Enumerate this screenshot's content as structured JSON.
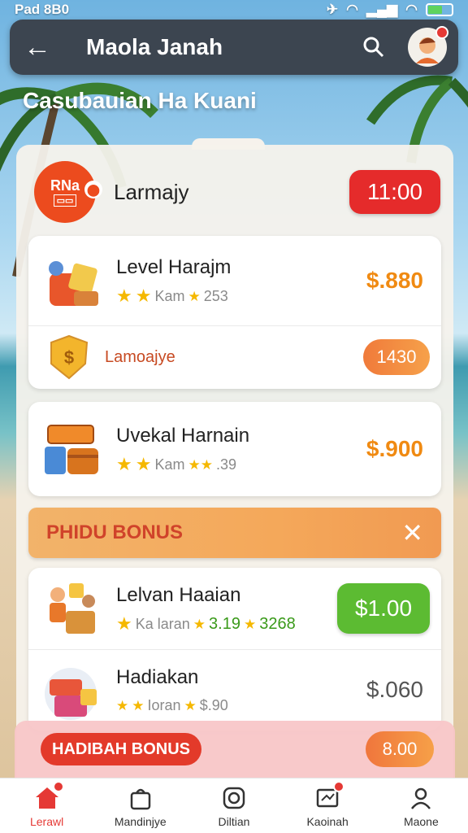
{
  "status_bar": {
    "left_text": "Pad 8B0",
    "battery_level": 0.6
  },
  "app_bar": {
    "title": "Maola Janah"
  },
  "section": {
    "title": "Casubauian Ha Kuani"
  },
  "header": {
    "name": "Larmajy",
    "timer": "11:00",
    "logo_text": "RNa"
  },
  "items": [
    {
      "name": "Level Harajm",
      "meta_label": "Kam",
      "meta_value": "253",
      "price": "$.880"
    },
    {
      "name": "Lamoajye",
      "badge": "1430"
    },
    {
      "name": "Uvekal Harnain",
      "meta_label": "Kam",
      "meta_value": ".39",
      "price": "$.900"
    }
  ],
  "bonus_banner": {
    "label": "PHIDU BONUS"
  },
  "items2": [
    {
      "name": "Lelvan Haaian",
      "meta_label": "Ka laran",
      "meta_value": "3.19",
      "meta_value2": "3268",
      "button": "$1.00"
    },
    {
      "name": "Hadiakan",
      "meta_label": "Ioran",
      "meta_value": "$.90",
      "price": "$.060"
    }
  ],
  "footer_bonus": {
    "tag": "HADIBAH BONUS",
    "value": "8.00"
  },
  "nav": [
    {
      "label": "Lerawl",
      "icon": "home-icon",
      "active": true
    },
    {
      "label": "Mandinjye",
      "icon": "bag-icon"
    },
    {
      "label": "Diltian",
      "icon": "circle-icon"
    },
    {
      "label": "Kaoinah",
      "icon": "message-icon"
    },
    {
      "label": "Maone",
      "icon": "profile-icon"
    }
  ],
  "colors": {
    "accent": "#e52b2b",
    "orange": "#f08a12",
    "green": "#5cbb32",
    "appbar": "#3c4550"
  }
}
